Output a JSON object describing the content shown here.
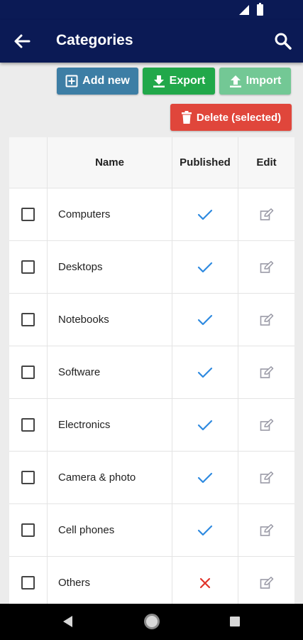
{
  "app_bar": {
    "title": "Categories",
    "back_icon": "arrow-left-icon",
    "search_icon": "search-icon"
  },
  "toolbar": {
    "add_label": "Add new",
    "export_label": "Export",
    "import_label": "Import",
    "delete_label": "Delete (selected)",
    "colors": {
      "add": "#3d7ea5",
      "export": "#21a84a",
      "import": "#73c895",
      "delete": "#e0463b"
    }
  },
  "table": {
    "headers": {
      "name": "Name",
      "published": "Published",
      "edit": "Edit"
    },
    "rows": [
      {
        "name": "Computers",
        "published": true
      },
      {
        "name": "Desktops",
        "published": true
      },
      {
        "name": "Notebooks",
        "published": true
      },
      {
        "name": "Software",
        "published": true
      },
      {
        "name": "Electronics",
        "published": true
      },
      {
        "name": "Camera & photo",
        "published": true
      },
      {
        "name": "Cell phones",
        "published": true
      },
      {
        "name": "Others",
        "published": false
      }
    ]
  },
  "colors": {
    "header_bg": "#0b1a55",
    "check": "#2e8ae0",
    "cross": "#e0342b"
  }
}
